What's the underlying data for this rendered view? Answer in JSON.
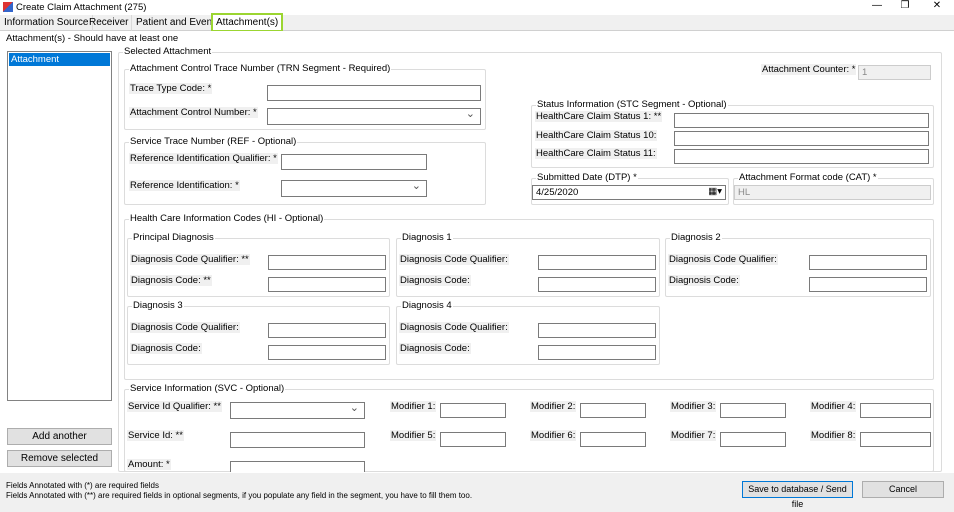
{
  "window": {
    "title": "Create Claim Attachment (275)",
    "minimize": "—",
    "restore": "❐",
    "close": "✕"
  },
  "tabs": [
    "Information Source",
    "Receiver",
    "Patient and Event",
    "Attachment(s)"
  ],
  "attachments_group": {
    "title": "Attachment(s) - Should have at least one",
    "items": [
      "Attachment"
    ],
    "add_label": "Add another",
    "remove_label": "Remove selected"
  },
  "selected": {
    "title": "Selected Attachment",
    "trn": {
      "title": "Attachment Control Trace Number (TRN Segment - Required)",
      "trace_type_label": "Trace Type Code: *",
      "trace_type_value": "",
      "acn_label": "Attachment Control Number: *",
      "acn_value": ""
    },
    "ref": {
      "title": "Service Trace Number (REF - Optional)",
      "qualifier_label": "Reference Identification Qualifier: *",
      "qualifier_value": "",
      "id_label": "Reference Identification: *",
      "id_value": ""
    },
    "counter": {
      "label": "Attachment Counter: *",
      "value": "1"
    },
    "stc": {
      "title": "Status Information (STC Segment - Optional)",
      "status1_label": "HealthCare Claim Status 1: **",
      "status10_label": "HealthCare Claim Status 10:",
      "status11_label": "HealthCare Claim Status 11:"
    },
    "dtp": {
      "title": "Submitted Date (DTP) *",
      "value": "4/25/2020"
    },
    "cat": {
      "title": "Attachment Format code (CAT) *",
      "value": "HL"
    },
    "hi": {
      "title": "Health Care Information Codes (HI - Optional)",
      "diagnoses": [
        {
          "title": "Principal Diagnosis",
          "qualifier_label": "Diagnosis Code Qualifier: **",
          "code_label": "Diagnosis Code: **"
        },
        {
          "title": "Diagnosis 1",
          "qualifier_label": "Diagnosis Code Qualifier:",
          "code_label": "Diagnosis Code:"
        },
        {
          "title": "Diagnosis 2",
          "qualifier_label": "Diagnosis Code Qualifier:",
          "code_label": "Diagnosis Code:"
        },
        {
          "title": "Diagnosis 3",
          "qualifier_label": "Diagnosis Code Qualifier:",
          "code_label": "Diagnosis Code:"
        },
        {
          "title": "Diagnosis 4",
          "qualifier_label": "Diagnosis Code Qualifier:",
          "code_label": "Diagnosis Code:"
        }
      ]
    },
    "svc": {
      "title": "Service Information (SVC - Optional)",
      "qualifier_label": "Service Id Qualifier: **",
      "id_label": "Service Id: **",
      "amount_label": "Amount: *",
      "modifiers": [
        "Modifier 1:",
        "Modifier 2:",
        "Modifier 3:",
        "Modifier 4:",
        "Modifier 5:",
        "Modifier 6:",
        "Modifier 7:",
        "Modifier 8:"
      ]
    }
  },
  "footer": {
    "note1": "Fields Annotated with (*) are required fields",
    "note2": "Fields Annotated with (**) are required fields in optional segments, if you populate any field in the segment, you have to fill them too.",
    "save_label": "Save to database / Send file",
    "cancel_label": "Cancel"
  }
}
